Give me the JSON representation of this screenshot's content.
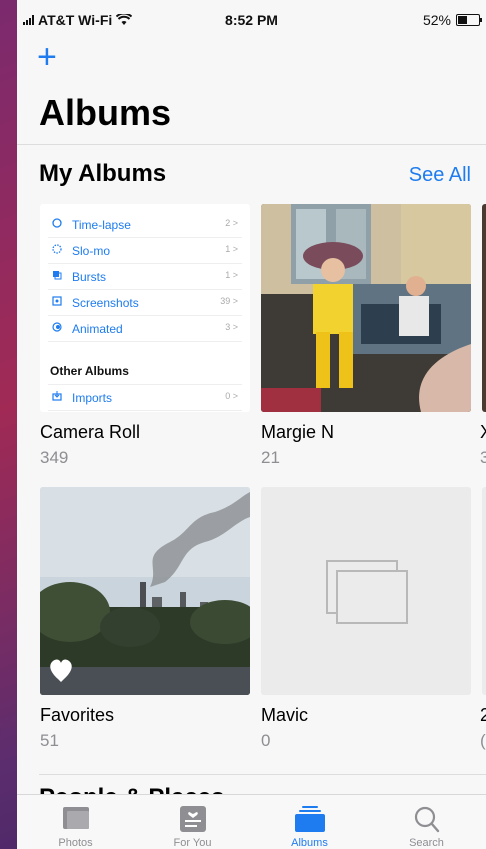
{
  "status_bar": {
    "carrier": "AT&T Wi-Fi",
    "time": "8:52 PM",
    "battery_percent": "52%",
    "battery_level": 0.52
  },
  "header": {
    "add_label": "+",
    "title": "Albums"
  },
  "my_albums": {
    "title": "My Albums",
    "see_all": "See All",
    "camera_roll_preview": {
      "items": [
        {
          "label": "Time-lapse",
          "count": "2 >",
          "icon": "time-lapse-icon"
        },
        {
          "label": "Slo-mo",
          "count": "1 >",
          "icon": "slo-mo-icon"
        },
        {
          "label": "Bursts",
          "count": "1 >",
          "icon": "bursts-icon"
        },
        {
          "label": "Screenshots",
          "count": "39 >",
          "icon": "screenshots-icon"
        },
        {
          "label": "Animated",
          "count": "3 >",
          "icon": "animated-icon"
        }
      ],
      "other_title": "Other Albums",
      "other_items": [
        {
          "label": "Imports",
          "count": "0 >",
          "icon": "imports-icon"
        }
      ]
    },
    "albums": [
      {
        "name": "Camera Roll",
        "count": "349"
      },
      {
        "name": "Margie N",
        "count": "21"
      },
      {
        "name": "Favorites",
        "count": "51"
      },
      {
        "name": "Mavic",
        "count": "0"
      }
    ],
    "partial_album_counts": [
      "3",
      "("
    ],
    "partial_album_name_first_char": "X",
    "partial_album_name_second_char": "2"
  },
  "next_section_title_partial": "People & Places",
  "tabbar": {
    "tabs": [
      {
        "label": "Photos",
        "icon": "photos-icon"
      },
      {
        "label": "For You",
        "icon": "for-you-icon"
      },
      {
        "label": "Albums",
        "icon": "albums-icon"
      },
      {
        "label": "Search",
        "icon": "search-icon"
      }
    ],
    "active": "Albums"
  },
  "colors": {
    "accent": "#1e7cf0",
    "secondary_text": "#8e8e93"
  }
}
